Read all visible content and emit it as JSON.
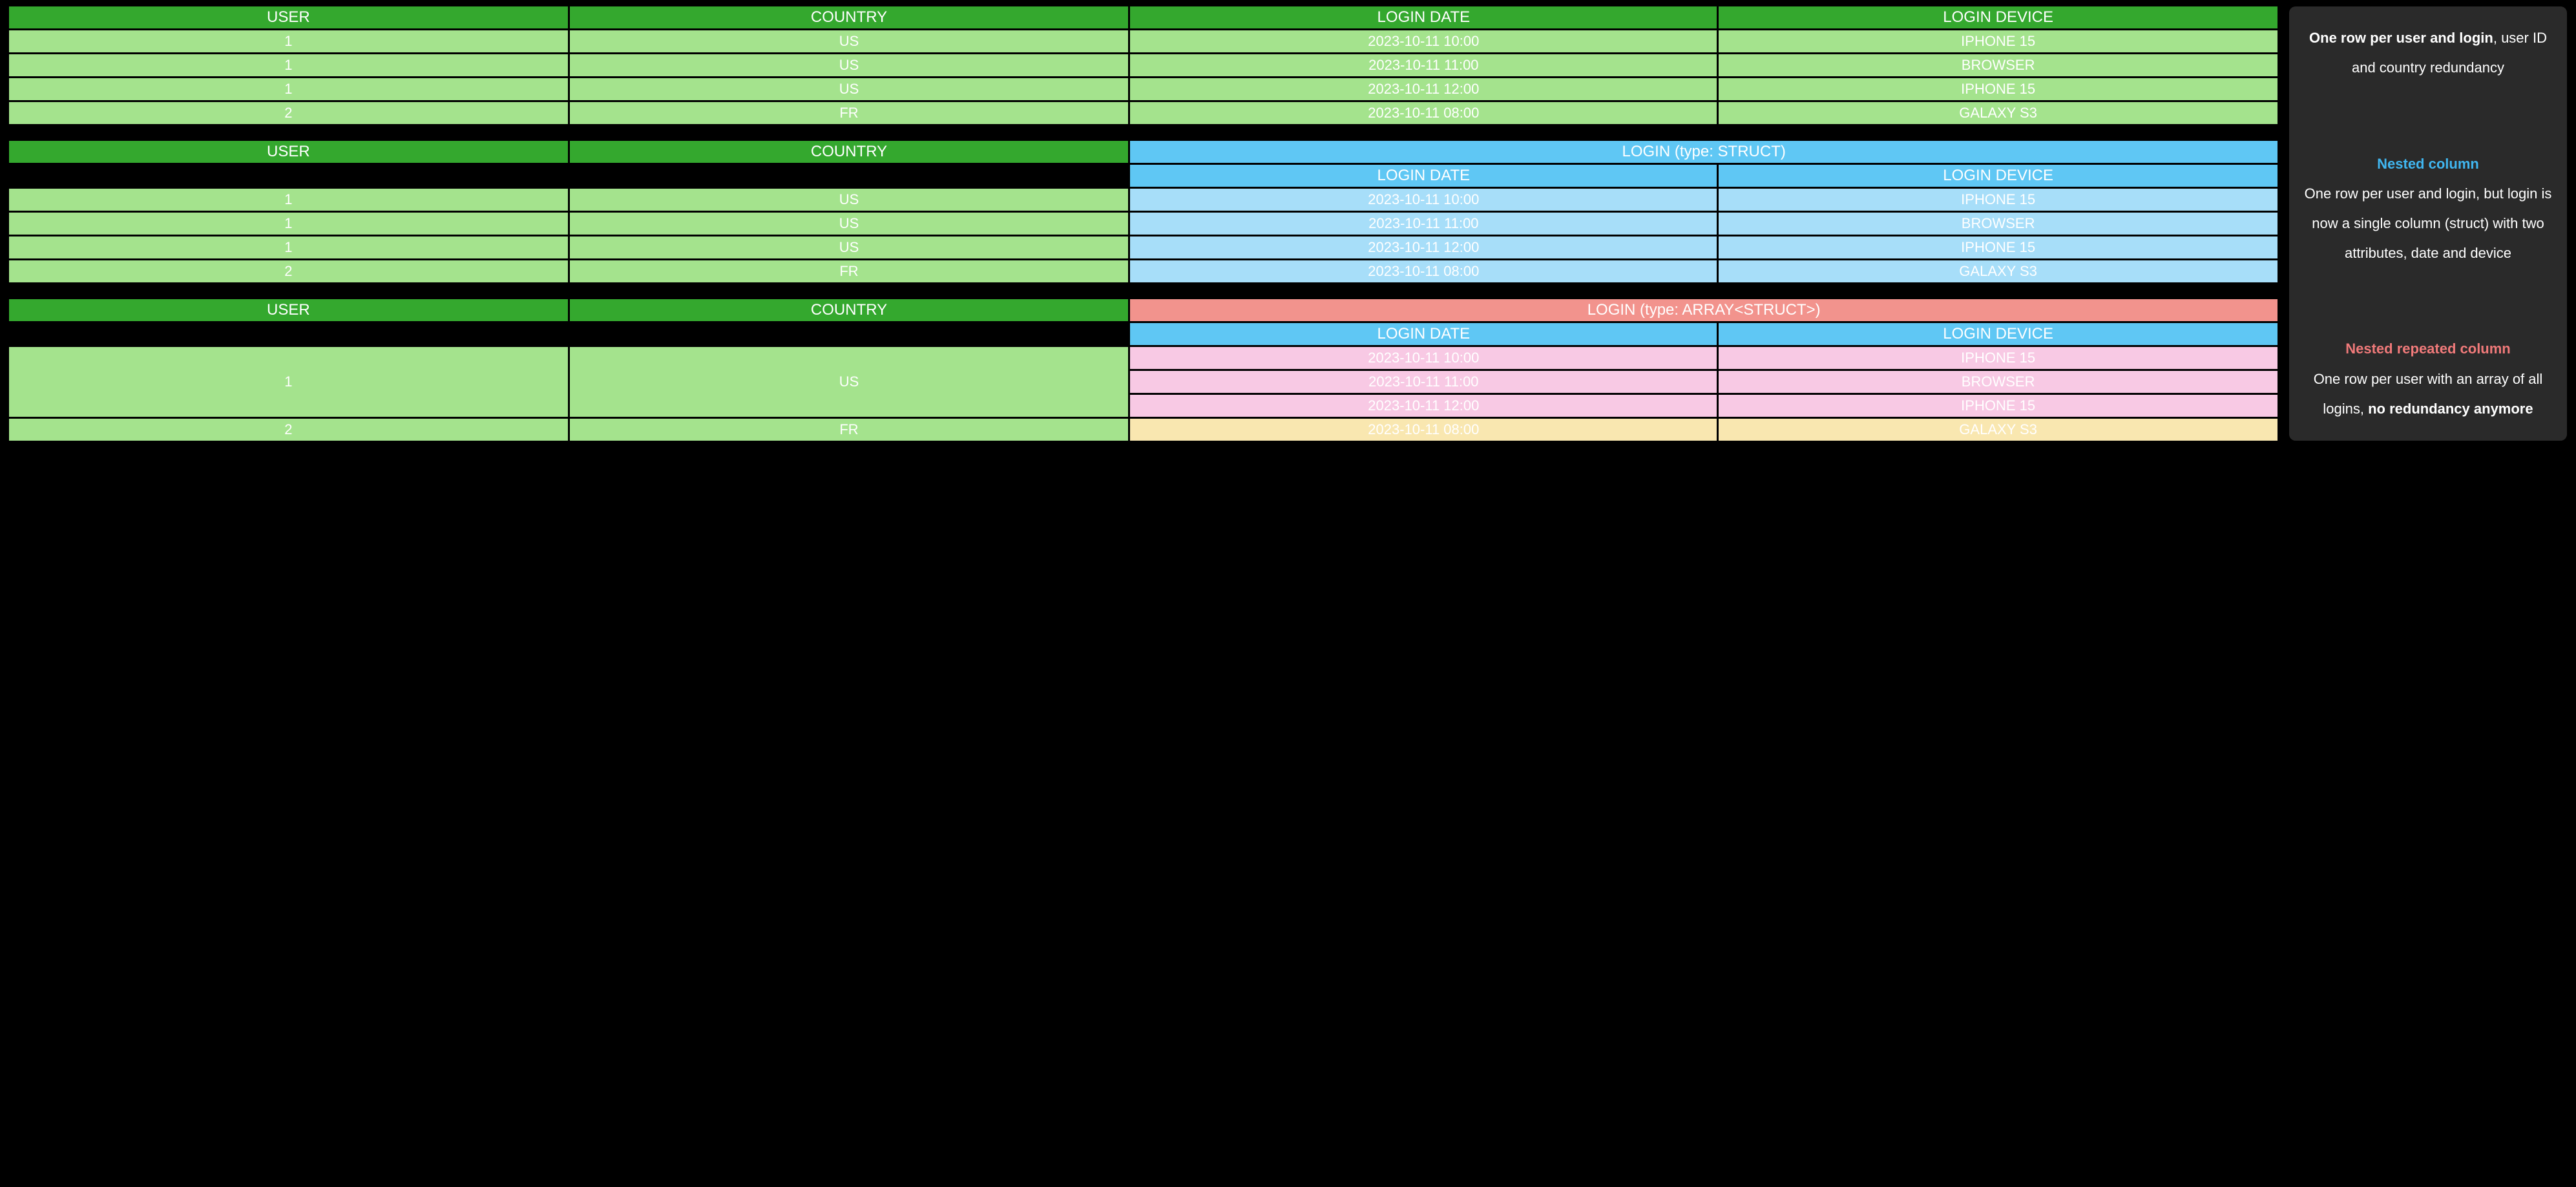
{
  "headers": {
    "user": "USER",
    "country": "COUNTRY",
    "login_date": "LOGIN DATE",
    "login_device": "LOGIN DEVICE",
    "login_struct": "LOGIN (type: STRUCT)",
    "login_array_struct": "LOGIN (type: ARRAY<STRUCT>)"
  },
  "table1": {
    "rows": [
      {
        "user": "1",
        "country": "US",
        "login_date": "2023-10-11 10:00",
        "login_device": "IPHONE 15"
      },
      {
        "user": "1",
        "country": "US",
        "login_date": "2023-10-11 11:00",
        "login_device": "BROWSER"
      },
      {
        "user": "1",
        "country": "US",
        "login_date": "2023-10-11 12:00",
        "login_device": "IPHONE 15"
      },
      {
        "user": "2",
        "country": "FR",
        "login_date": "2023-10-11 08:00",
        "login_device": "GALAXY S3"
      }
    ]
  },
  "table2": {
    "rows": [
      {
        "user": "1",
        "country": "US",
        "login_date": "2023-10-11 10:00",
        "login_device": "IPHONE 15"
      },
      {
        "user": "1",
        "country": "US",
        "login_date": "2023-10-11 11:00",
        "login_device": "BROWSER"
      },
      {
        "user": "1",
        "country": "US",
        "login_date": "2023-10-11 12:00",
        "login_device": "IPHONE 15"
      },
      {
        "user": "2",
        "country": "FR",
        "login_date": "2023-10-11 08:00",
        "login_device": "GALAXY S3"
      }
    ]
  },
  "table3": {
    "users": [
      {
        "user": "1",
        "country": "US",
        "logins": [
          {
            "login_date": "2023-10-11 10:00",
            "login_device": "IPHONE 15"
          },
          {
            "login_date": "2023-10-11 11:00",
            "login_device": "BROWSER"
          },
          {
            "login_date": "2023-10-11 12:00",
            "login_device": "IPHONE 15"
          }
        ]
      },
      {
        "user": "2",
        "country": "FR",
        "logins": [
          {
            "login_date": "2023-10-11 08:00",
            "login_device": "GALAXY S3"
          }
        ]
      }
    ]
  },
  "captions": {
    "flat": {
      "bold": "One row per user and login",
      "rest": ", user ID and country redundancy"
    },
    "struct": {
      "title": "Nested column",
      "body": "One row per user and login, but login is now a single column (struct) with two attributes, date and device"
    },
    "array": {
      "title": "Nested repeated column",
      "body_pre": "One row per user with an array of all logins, ",
      "body_bold": "no redundancy anymore"
    }
  }
}
